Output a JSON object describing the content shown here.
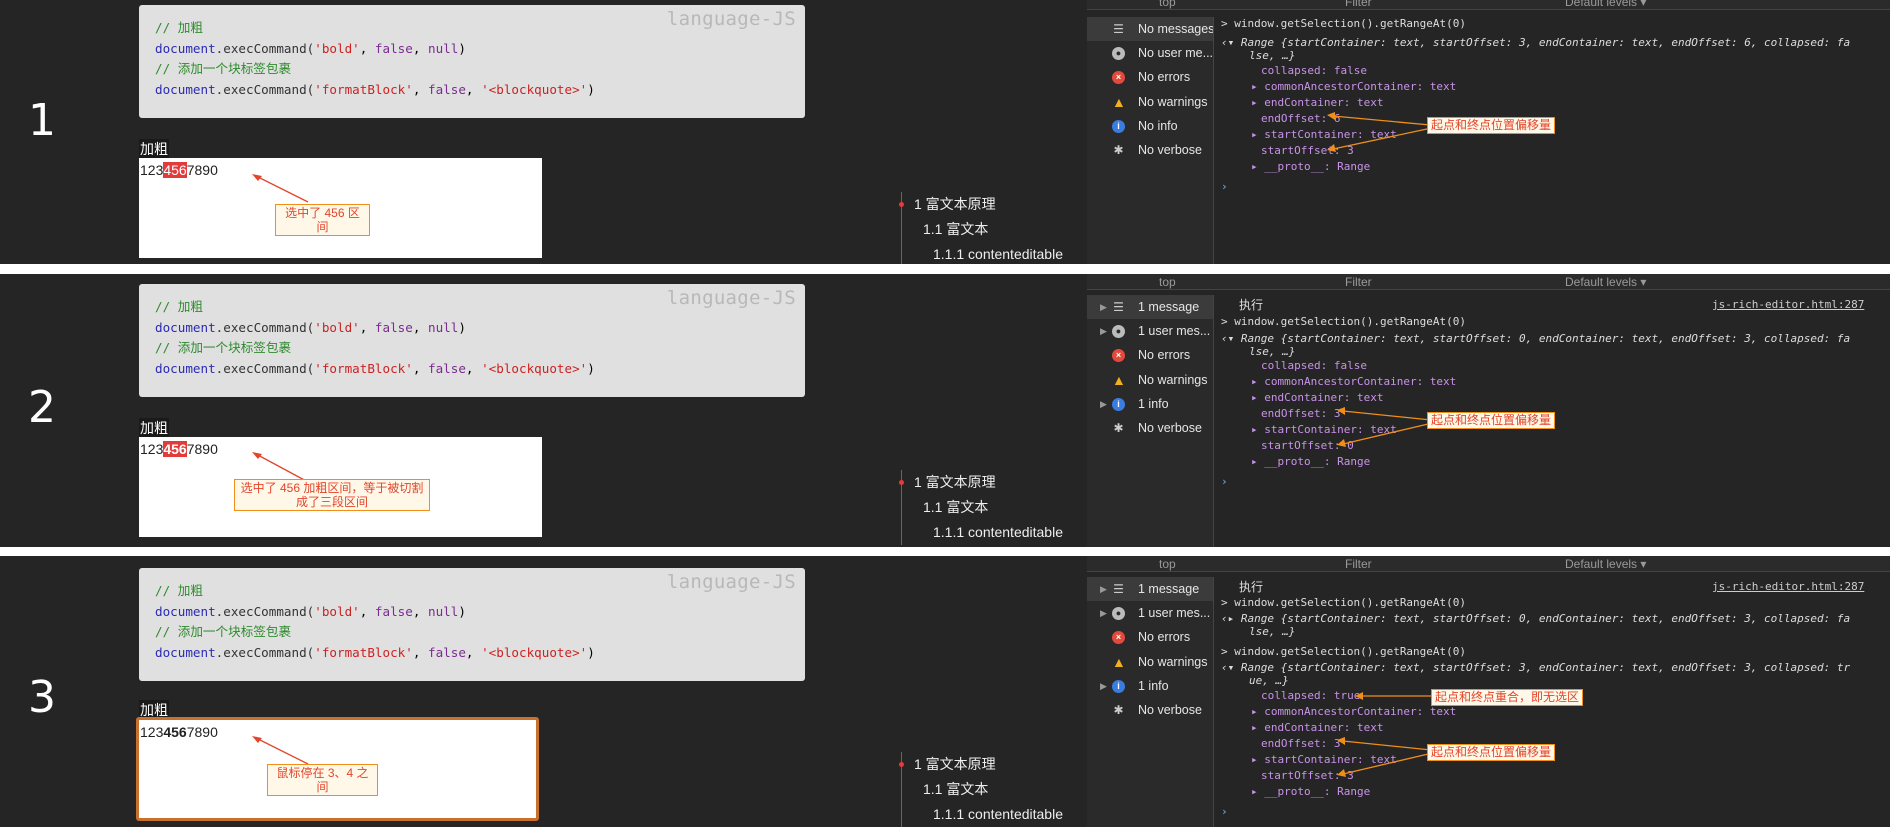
{
  "code": {
    "lang": "language-JS",
    "comment1": "// 加粗",
    "line1_obj": "document",
    "line1_fn": ".execCommand(",
    "line1_str": "'bold'",
    "line1_sep1": ", ",
    "line1_kw": "false",
    "line1_sep2": ", ",
    "line1_kw2": "null",
    "line1_end": ")",
    "comment2": "// 添加一个块标签包裹",
    "line2_obj": "document",
    "line2_fn": ".execCommand(",
    "line2_str": "'formatBlock'",
    "line2_sep1": ", ",
    "line2_kw": "false",
    "line2_sep2": ", ",
    "line2_str2": "'<blockquote>'",
    "line2_end": ")"
  },
  "editor_label": "加粗",
  "editor_text": {
    "a": "123",
    "b": "456",
    "c": "7890"
  },
  "toc": [
    "1 富文本原理",
    "1.1 富文本",
    "1.1.1 contenteditable"
  ],
  "sidebar_icon_colors": {
    "error": "#e34a3c",
    "warning": "#f2b11c",
    "info": "#3b7ce0"
  },
  "panels": [
    {
      "number": "1",
      "note": "选中了 456 区间",
      "sidebar": [
        "No messages",
        "No user me...",
        "No errors",
        "No warnings",
        "No info",
        "No verbose"
      ],
      "toolbar": {
        "context": "top",
        "filter": "Filter",
        "levels": "Default levels ▾"
      },
      "console": {
        "cmd": "window.getSelection().getRangeAt(0)",
        "range_head": "Range {startContainer: text, startOffset: 3, endContainer: text, endOffset: 6, collapsed: fa",
        "range_tail": "lse, …}",
        "collapsed": "collapsed: false",
        "common": "commonAncestorContainer: text",
        "endC": "endContainer: text",
        "endO": "endOffset: 6",
        "startC": "startContainer: text",
        "startO": "startOffset: 3",
        "proto": "__proto__: Range",
        "note": "起点和终点位置偏移量"
      }
    },
    {
      "number": "2",
      "note": "选中了 456 加粗区间，等于被切割成了三段区间",
      "sidebar": [
        "1 message",
        "1 user mes...",
        "No errors",
        "No warnings",
        "1 info",
        "No verbose"
      ],
      "toolbar": {
        "context": "top",
        "filter": "Filter",
        "levels": "Default levels ▾"
      },
      "console": {
        "exec": "执行",
        "src": "js-rich-editor.html:287",
        "cmd": "window.getSelection().getRangeAt(0)",
        "range_head": "Range {startContainer: text, startOffset: 0, endContainer: text, endOffset: 3, collapsed: fa",
        "range_tail": "lse, …}",
        "collapsed": "collapsed: false",
        "common": "commonAncestorContainer: text",
        "endC": "endContainer: text",
        "endO": "endOffset: 3",
        "startC": "startContainer: text",
        "startO": "startOffset: 0",
        "proto": "__proto__: Range",
        "note": "起点和终点位置偏移量"
      }
    },
    {
      "number": "3",
      "note": "鼠标停在 3、4 之间",
      "sidebar": [
        "1 message",
        "1 user mes...",
        "No errors",
        "No warnings",
        "1 info",
        "No verbose"
      ],
      "toolbar": {
        "context": "top",
        "filter": "Filter",
        "levels": "Default levels ▾"
      },
      "console": {
        "exec": "执行",
        "src": "js-rich-editor.html:287",
        "cmd": "window.getSelection().getRangeAt(0)",
        "prev_head": "Range {startContainer: text, startOffset: 0, endContainer: text, endOffset: 3, collapsed: fa",
        "prev_tail": "lse, …}",
        "cmd2": "window.getSelection().getRangeAt(0)",
        "range_head": "Range {startContainer: text, startOffset: 3, endContainer: text, endOffset: 3, collapsed: tr",
        "range_tail": "ue, …}",
        "collapsed": "collapsed: true",
        "common": "commonAncestorContainer: text",
        "endC": "endContainer: text",
        "endO": "endOffset: 3",
        "startC": "startContainer: text",
        "startO": "startOffset: 3",
        "proto": "__proto__: Range",
        "note_collapsed": "起点和终点重合，即无选区",
        "note": "起点和终点位置偏移量"
      }
    }
  ]
}
